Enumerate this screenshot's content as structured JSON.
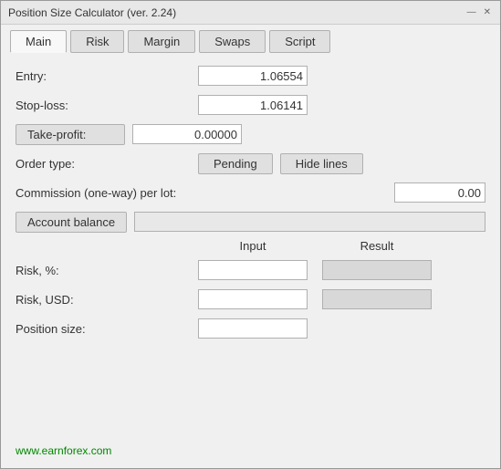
{
  "window": {
    "title": "Position Size Calculator (ver. 2.24)",
    "minimize_label": "—",
    "close_label": "✕"
  },
  "tabs": [
    {
      "id": "main",
      "label": "Main",
      "active": true
    },
    {
      "id": "risk",
      "label": "Risk",
      "active": false
    },
    {
      "id": "margin",
      "label": "Margin",
      "active": false
    },
    {
      "id": "swaps",
      "label": "Swaps",
      "active": false
    },
    {
      "id": "script",
      "label": "Script",
      "active": false
    }
  ],
  "fields": {
    "entry_label": "Entry:",
    "entry_value": "1.06554",
    "stoploss_label": "Stop-loss:",
    "stoploss_value": "1.06141",
    "takeprofit_label": "Take-profit:",
    "takeprofit_value": "0.00000",
    "ordertype_label": "Order type:",
    "ordertype_btn": "Pending",
    "hidelines_btn": "Hide lines",
    "commission_label": "Commission (one-way) per lot:",
    "commission_value": "0.00",
    "accountbalance_btn": "Account balance",
    "input_col_header": "Input",
    "result_col_header": "Result",
    "risk_pct_label": "Risk, %:",
    "risk_usd_label": "Risk, USD:",
    "positionsize_label": "Position size:",
    "footer_link": "www.earnforex.com"
  }
}
